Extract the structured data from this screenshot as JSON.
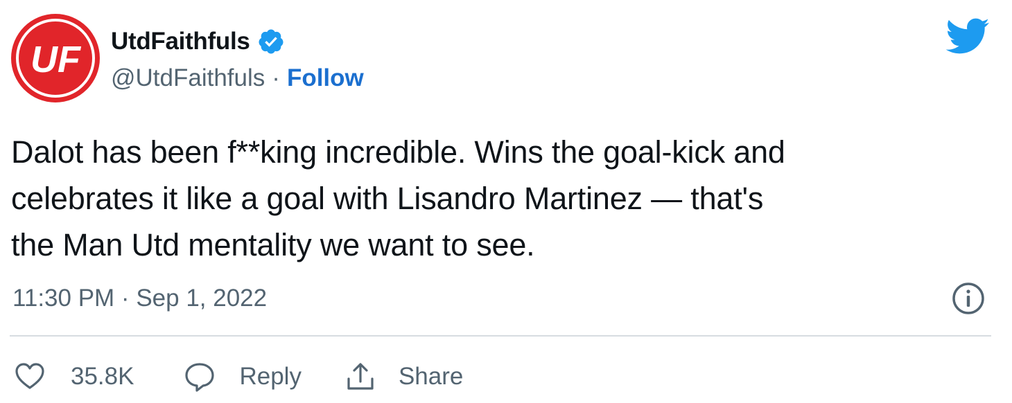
{
  "user": {
    "display_name": "UtdFaithfuls",
    "handle": "@UtdFaithfuls",
    "separator": "·",
    "follow_label": "Follow",
    "avatar_icon": "uf-logo-avatar",
    "verified_icon": "verified-badge-icon",
    "avatar_text": "UF"
  },
  "brand_icon": "twitter-bird-icon",
  "tweet": {
    "text_lines": [
      "Dalot has been f**king incredible. Wins the goal-kick and",
      "celebrates it like a goal with Lisandro Martinez — that's",
      "the Man Utd mentality we want to see."
    ],
    "timestamp": "11:30 PM · Sep 1, 2022",
    "info_icon": "info-icon"
  },
  "actions": {
    "like_count": "35.8K",
    "like_icon": "heart-icon",
    "reply_label": "Reply",
    "reply_icon": "speech-bubble-icon",
    "share_label": "Share",
    "share_icon": "share-upload-icon"
  },
  "colors": {
    "twitter_blue": "#1d9bf0",
    "follow_blue": "#1b6fcf",
    "avatar_red": "#e1252a",
    "muted_text": "#536471",
    "body_text": "#0f1419"
  }
}
